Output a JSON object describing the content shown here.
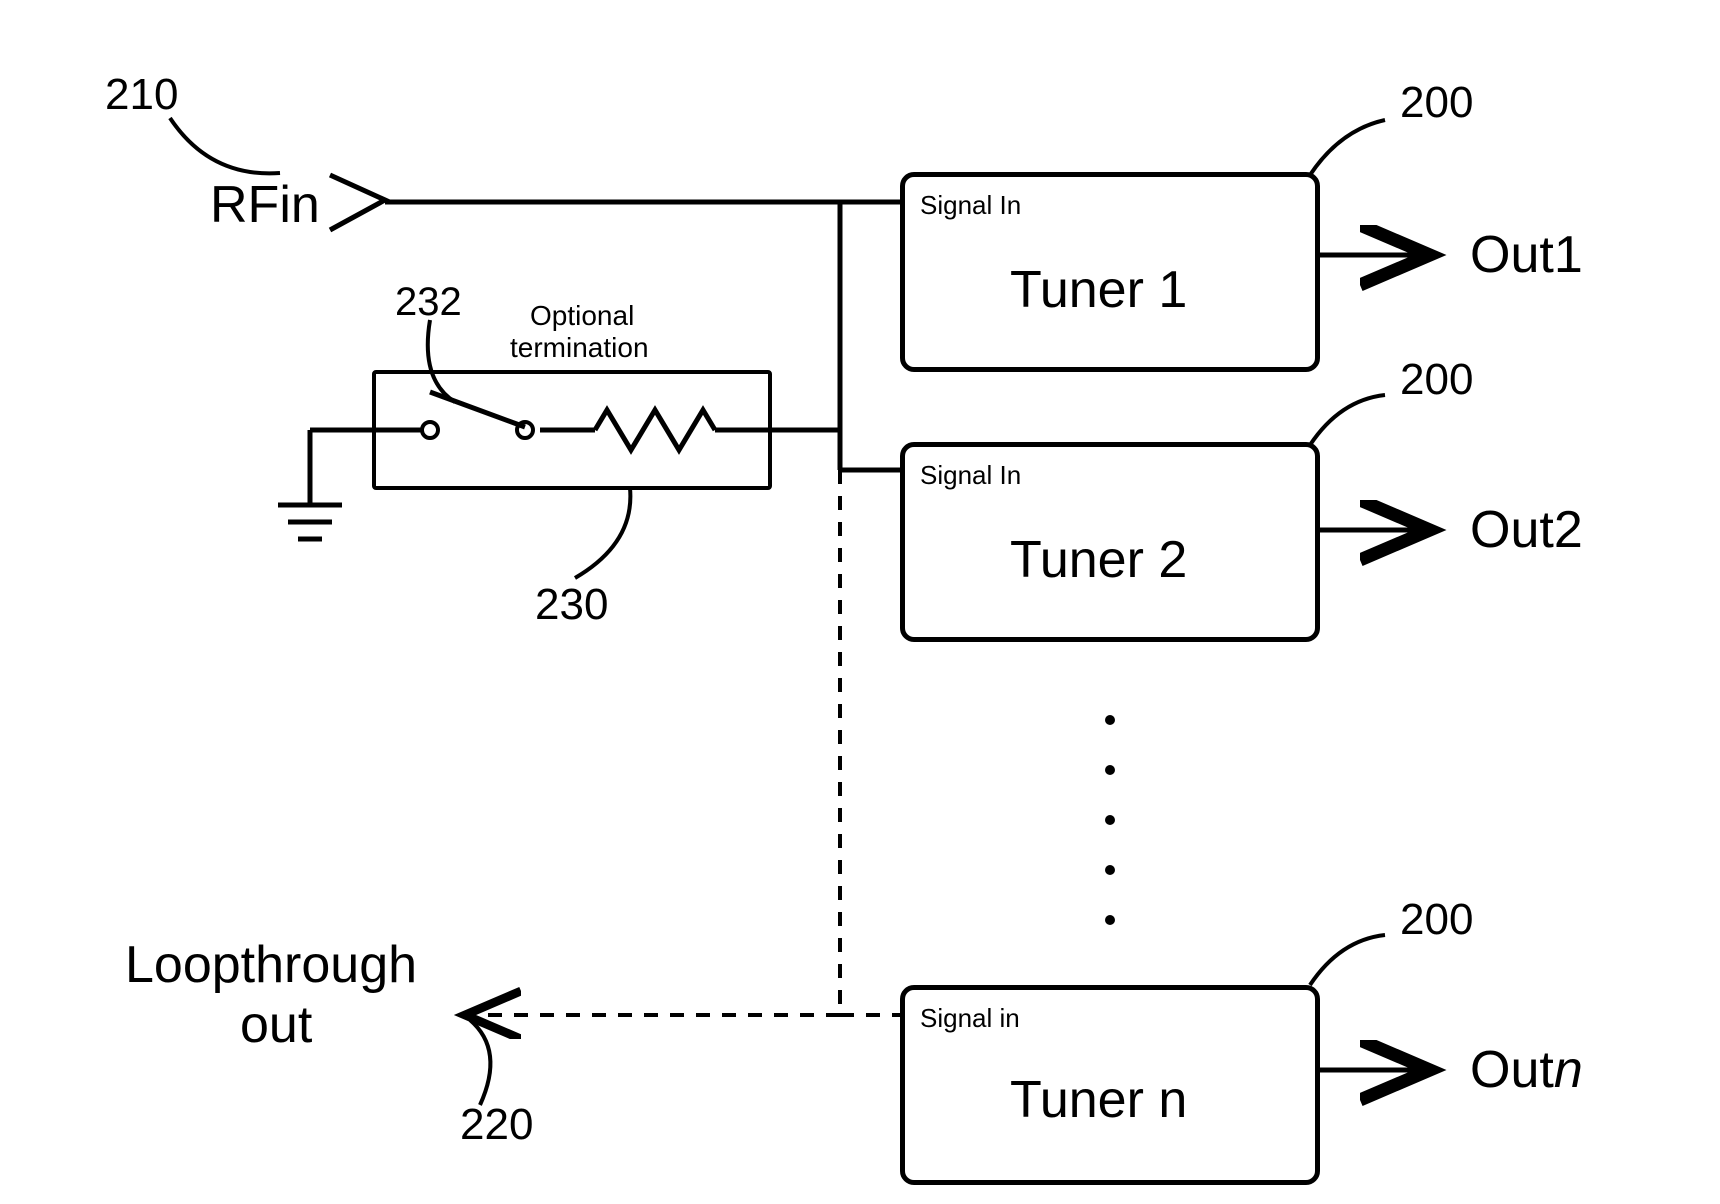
{
  "refs": {
    "rfin_ref": "210",
    "opt_term_ref": "230",
    "switch_ref": "232",
    "loopthrough_ref": "220",
    "tuner_ref": "200"
  },
  "labels": {
    "rfin": "RFin",
    "optional_term_l1": "Optional",
    "optional_term_l2": "termination",
    "loopthrough_l1": "Loopthrough",
    "loopthrough_l2": "out",
    "signal_in": "Signal In",
    "signal_in_lower": "Signal in",
    "tuner1": "Tuner 1",
    "tuner2": "Tuner 2",
    "tunern": "Tuner n",
    "out1": "Out1",
    "out2": "Out2",
    "outn_prefix": "Out",
    "outn_suffix": "n"
  }
}
